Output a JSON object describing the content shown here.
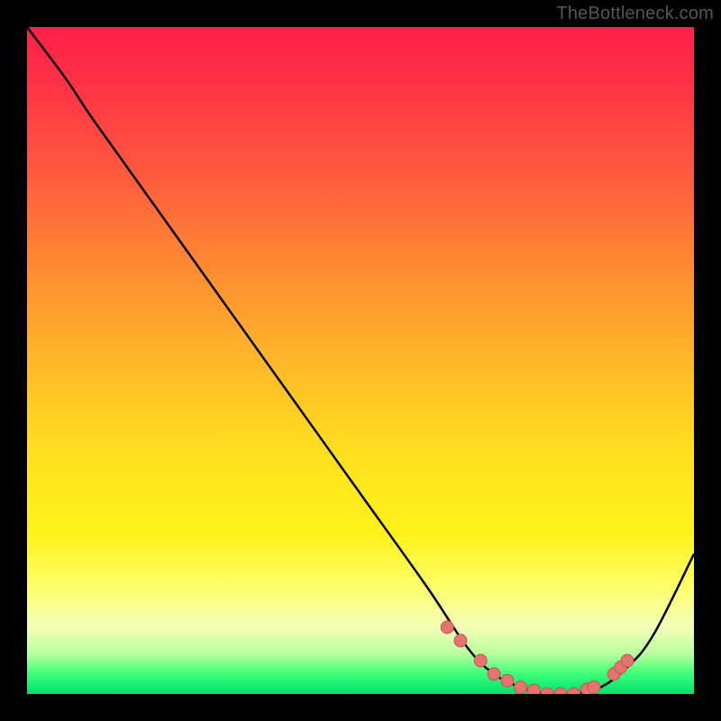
{
  "watermark": "TheBottleneck.com",
  "colors": {
    "curve_stroke": "#000000",
    "marker_fill": "#e4746f",
    "marker_stroke": "#c9554f",
    "gradient_top": "#ff1f4a",
    "gradient_bottom": "#00e06a",
    "page_bg": "#000000"
  },
  "chart_data": {
    "type": "line",
    "title": "",
    "xlabel": "",
    "ylabel": "",
    "xlim": [
      0,
      100
    ],
    "ylim": [
      0,
      100
    ],
    "grid": false,
    "legend": false,
    "series": [
      {
        "name": "bottleneck-curve",
        "x": [
          0,
          6,
          10,
          20,
          30,
          40,
          50,
          60,
          66,
          70,
          74,
          78,
          82,
          86,
          90,
          94,
          100
        ],
        "y": [
          100,
          92,
          86,
          72,
          58,
          44,
          30,
          16,
          7,
          3,
          1,
          0,
          0,
          1,
          4,
          9,
          21
        ]
      }
    ],
    "markers": {
      "name": "highlighted-points",
      "x": [
        63,
        65,
        68,
        70,
        72,
        74,
        76,
        78,
        80,
        82,
        84,
        85,
        88,
        89,
        90
      ],
      "y": [
        10,
        8,
        5,
        3,
        2,
        1,
        0.5,
        0,
        0,
        0,
        0.7,
        1,
        3,
        4,
        5
      ]
    }
  }
}
